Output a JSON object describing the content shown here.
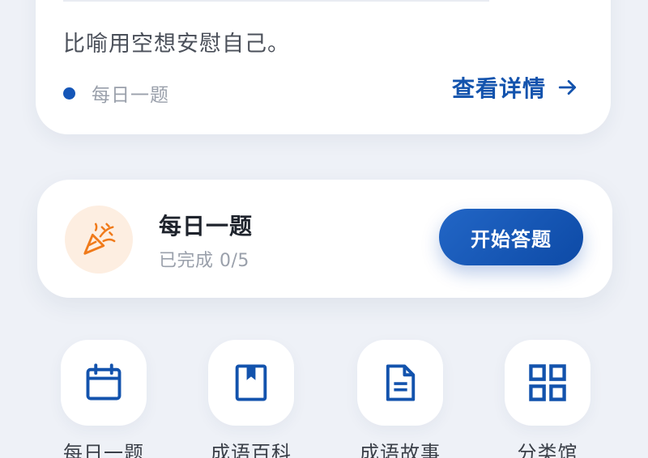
{
  "top_card": {
    "quote": "比喻用空想安慰自己。",
    "tag_label": "每日一题",
    "detail_label": "查看详情"
  },
  "daily": {
    "title": "每日一题",
    "progress": "已完成 0/5",
    "start_label": "开始答题"
  },
  "quick_links": [
    {
      "label": "每日一题",
      "icon": "calendar-icon"
    },
    {
      "label": "成语百科",
      "icon": "bookmark-book-icon"
    },
    {
      "label": "成语故事",
      "icon": "document-icon"
    },
    {
      "label": "分类馆",
      "icon": "grid-icon"
    }
  ],
  "colors": {
    "accent": "#1353ad",
    "button_gradient_start": "#2266c6",
    "button_gradient_end": "#0d4aa6",
    "party_icon": "#f07a1a",
    "party_badge_bg": "#fdeee1",
    "background": "#eef1f7"
  }
}
